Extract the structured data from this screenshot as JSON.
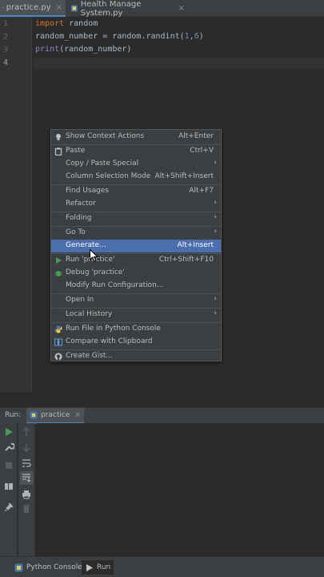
{
  "tabs": [
    {
      "label": "practice.py",
      "icon": "python-file-icon",
      "active": true
    },
    {
      "label": "Health Manage System.py",
      "icon": "python-file-icon",
      "active": false
    }
  ],
  "gutter": {
    "line_numbers": [
      "1",
      "2",
      "3",
      "4"
    ]
  },
  "code": {
    "line1": {
      "keyword": "import",
      "rest": " random"
    },
    "line2": {
      "prefix": "random_number = random.randint(",
      "arg1": "1",
      "comma": ",",
      "arg2": "6",
      "suffix": ")"
    },
    "line3": {
      "builtin": "print",
      "rest": "(random_number)"
    }
  },
  "context_menu": {
    "items": [
      {
        "label": "Show Context Actions",
        "shortcut": "Alt+Enter",
        "icon": "lightbulb-icon"
      },
      {
        "label": "Paste",
        "shortcut": "Ctrl+V",
        "icon": "clipboard-icon"
      },
      {
        "label": "Copy / Paste Special",
        "shortcut": "",
        "submenu": true
      },
      {
        "label": "Column Selection Mode",
        "shortcut": "Alt+Shift+Insert"
      },
      {
        "label": "Find Usages",
        "shortcut": "Alt+F7"
      },
      {
        "label": "Refactor",
        "shortcut": "",
        "submenu": true
      },
      {
        "label": "Folding",
        "shortcut": "",
        "submenu": true
      },
      {
        "label": "Go To",
        "shortcut": "",
        "submenu": true
      },
      {
        "label": "Generate...",
        "shortcut": "Alt+Insert",
        "selected": true
      },
      {
        "label": "Run 'practice'",
        "shortcut": "Ctrl+Shift+F10",
        "icon": "run-icon"
      },
      {
        "label": "Debug 'practice'",
        "shortcut": "",
        "icon": "debug-icon"
      },
      {
        "label": "Modify Run Configuration...",
        "shortcut": ""
      },
      {
        "label": "Open In",
        "shortcut": "",
        "submenu": true
      },
      {
        "label": "Local History",
        "shortcut": "",
        "submenu": true
      },
      {
        "label": "Run File in Python Console",
        "shortcut": "",
        "icon": "python-icon"
      },
      {
        "label": "Compare with Clipboard",
        "shortcut": "",
        "icon": "compare-icon"
      },
      {
        "label": "Create Gist...",
        "shortcut": "",
        "icon": "github-icon"
      }
    ]
  },
  "run_panel": {
    "label": "Run:",
    "tab_label": "practice"
  },
  "bottom_bar": {
    "python_console_label": "Python Console",
    "run_label": "Run"
  },
  "colors": {
    "accent": "#4b6eaf",
    "run_green": "#499c54",
    "keyword": "#cc7832"
  }
}
